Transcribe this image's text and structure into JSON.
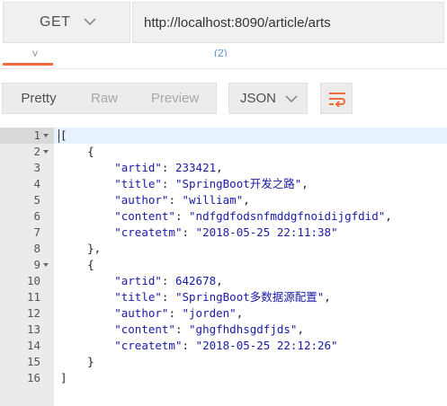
{
  "request": {
    "method": "GET",
    "url": "http://localhost:8090/article/arts"
  },
  "response_tabs": {
    "fragment_left": "y",
    "fragment_mid": "(2)"
  },
  "toolbar": {
    "views": [
      "Pretty",
      "Raw",
      "Preview"
    ],
    "format": "JSON"
  },
  "colors": {
    "accent": "#f26b3a",
    "json_token": "#1a1aa6"
  },
  "code_lines": [
    "[",
    "    {",
    "        \"artid\": 233421,",
    "        \"title\": \"SpringBoot开发之路\",",
    "        \"author\": \"william\",",
    "        \"content\": \"ndfgdfodsnfmddgfnoidijgfdid\",",
    "        \"createtm\": \"2018-05-25 22:11:38\"",
    "    },",
    "    {",
    "        \"artid\": 642678,",
    "        \"title\": \"SpringBoot多数据源配置\",",
    "        \"author\": \"jorden\",",
    "        \"content\": \"ghgfhdhsgdfjds\",",
    "        \"createtm\": \"2018-05-25 22:12:26\"",
    "    }",
    "]"
  ],
  "line_numbers": [
    "1",
    "2",
    "3",
    "4",
    "5",
    "6",
    "7",
    "8",
    "9",
    "10",
    "11",
    "12",
    "13",
    "14",
    "15",
    "16"
  ],
  "fold_lines": [
    1,
    2,
    9
  ]
}
